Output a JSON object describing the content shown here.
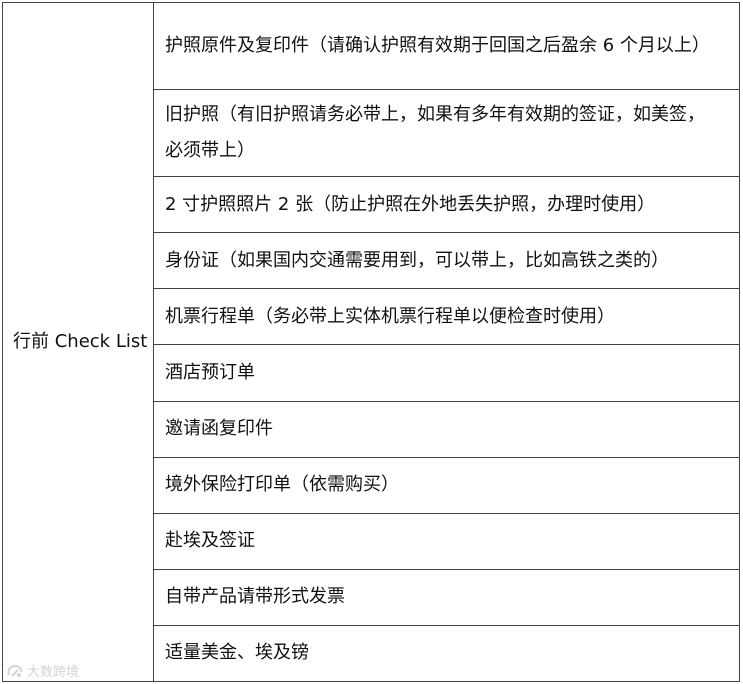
{
  "table": {
    "category": "行前 Check List",
    "items": [
      "护照原件及复印件（请确认护照有效期于回国之后盈余 6 个月以上）",
      "旧护照（有旧护照请务必带上，如果有多年有效期的签证，如美签，必须带上）",
      "2 寸护照照片 2 张（防止护照在外地丢失护照，办理时使用）",
      "身份证（如果国内交通需要用到，可以带上，比如高铁之类的）",
      "机票行程单（务必带上实体机票行程单以便检查时使用）",
      "酒店预订单",
      "邀请函复印件",
      "境外保险打印单（依需购买）",
      "赴埃及签证",
      "自带产品请带形式发票",
      "适量美金、埃及镑"
    ]
  },
  "watermark": {
    "text": "大数跨境",
    "icon": "brand-logo-icon"
  }
}
